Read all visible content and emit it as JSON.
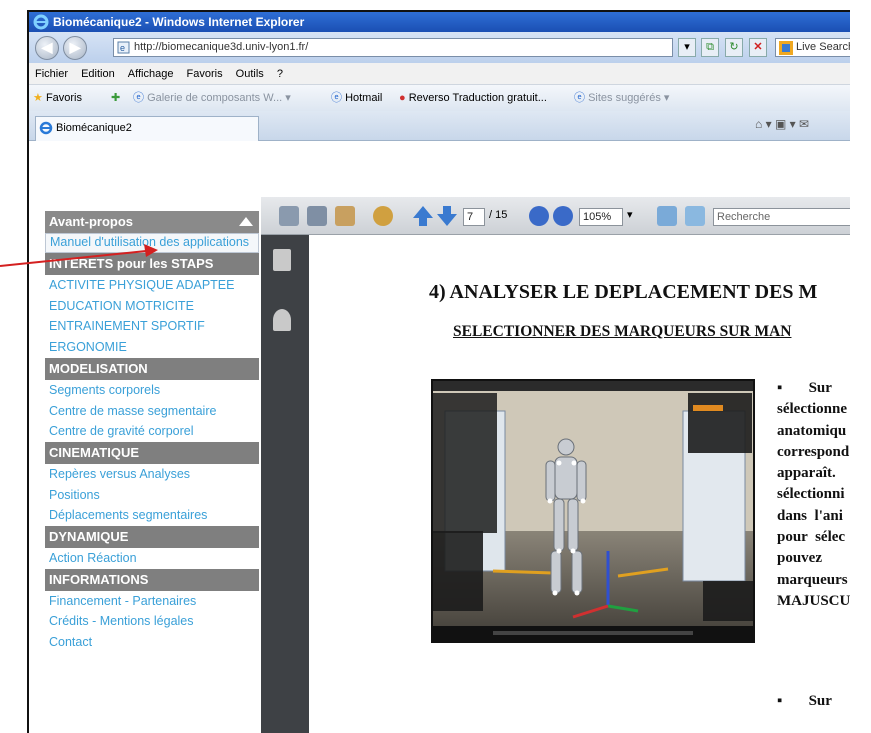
{
  "window": {
    "title": "Biomécanique2 - Windows Internet Explorer"
  },
  "address_bar": {
    "url": "http://biomecanique3d.univ-lyon1.fr/",
    "search_placeholder": "Live Search"
  },
  "menu": {
    "items": [
      "Fichier",
      "Edition",
      "Affichage",
      "Favoris",
      "Outils",
      "?"
    ]
  },
  "favorites_bar": {
    "favorites_label": "Favoris",
    "gallery": "Galerie de composants W...",
    "hotmail": "Hotmail",
    "reverso": "Reverso Traduction gratuit...",
    "suggested": "Sites suggérés"
  },
  "tab": {
    "label": "Biomécanique2"
  },
  "sidebar": {
    "sections": [
      {
        "title": "Avant-propos",
        "links": [
          "Manuel d'utilisation des applications"
        ]
      },
      {
        "title": "INTERETS pour les STAPS",
        "links": [
          "ACTIVITE PHYSIQUE ADAPTEE",
          "EDUCATION MOTRICITE",
          "ENTRAINEMENT SPORTIF",
          "ERGONOMIE"
        ]
      },
      {
        "title": "MODELISATION",
        "links": [
          "Segments corporels",
          "Centre de masse segmentaire",
          "Centre de gravité corporel"
        ]
      },
      {
        "title": "CINEMATIQUE",
        "links": [
          "Repères versus Analyses",
          "Positions",
          "Déplacements segmentaires"
        ]
      },
      {
        "title": "DYNAMIQUE",
        "links": [
          "Action Réaction"
        ]
      },
      {
        "title": "INFORMATIONS",
        "links": [
          "Financement - Partenaires",
          "Crédits - Mentions légales",
          "Contact"
        ]
      }
    ]
  },
  "pdf_viewer": {
    "current_page": "7",
    "total_pages": "/ 15",
    "zoom": "105%",
    "search_placeholder": "Recherche"
  },
  "document": {
    "heading": "4) ANALYSER LE DEPLACEMENT DES M",
    "subheading": "SELECTIONNER DES MARQUEURS SUR MAN",
    "paragraph_lines": [
      "▪       Sur",
      "sélectionne",
      "anatomiqu",
      "correspond",
      "apparaît.",
      "sélectionni",
      "dans  l'ani",
      "pour  sélec",
      "pouvez",
      "marqueurs",
      "MAJUSCUL"
    ],
    "bullet2": "▪       Sur"
  },
  "colors": {
    "sidebar_link": "#3aa0d8",
    "sidebar_header": "#7f7f7f",
    "arrow": "#d42020"
  }
}
